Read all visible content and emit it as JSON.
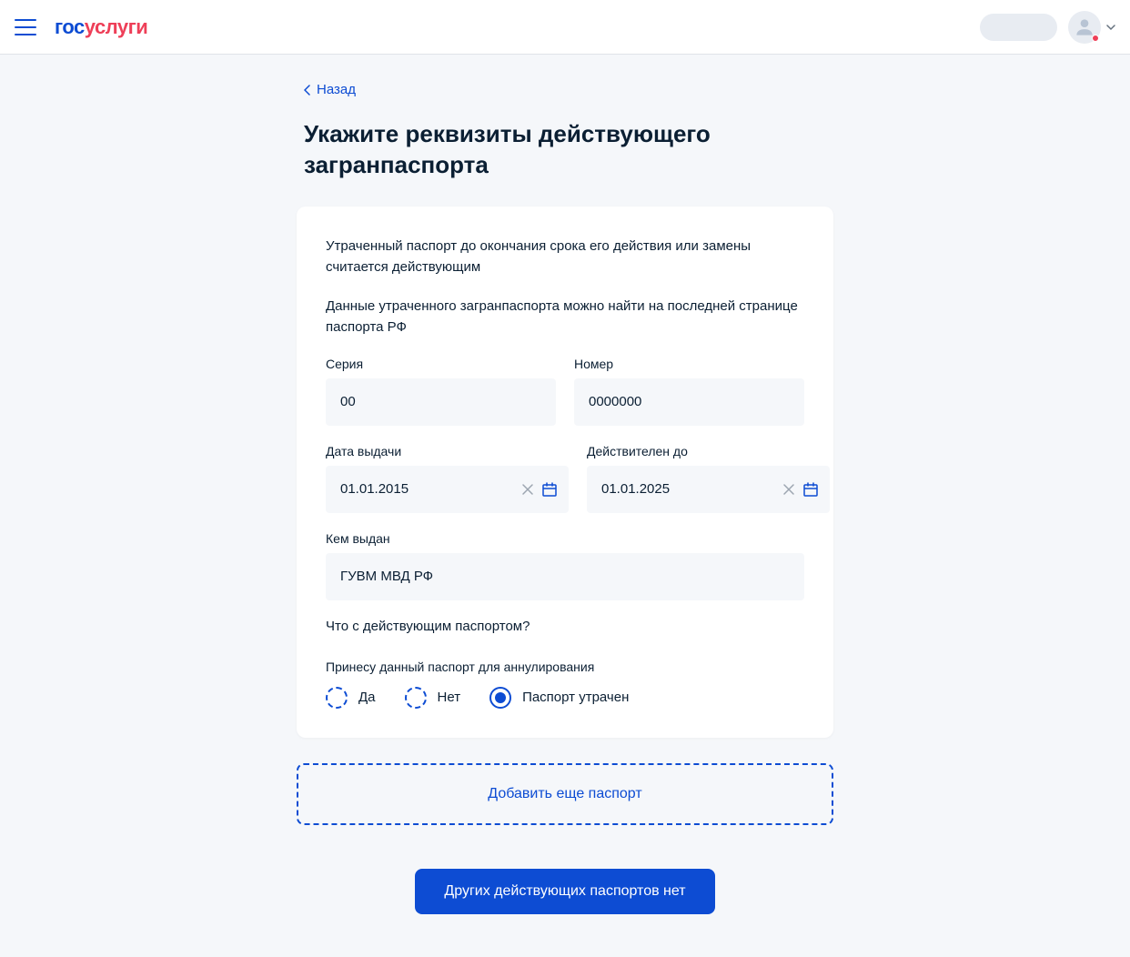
{
  "header": {
    "logo_part1": "гос",
    "logo_part2": "услуги"
  },
  "back": {
    "label": "Назад"
  },
  "page": {
    "title": "Укажите реквизиты действующего загранпаспорта"
  },
  "card": {
    "info1": "Утраченный паспорт до окончания срока его действия или замены считается действующим",
    "info2": "Данные утраченного загранпаспорта можно найти на последней странице паспорта РФ",
    "fields": {
      "series_label": "Серия",
      "series_value": "00",
      "number_label": "Номер",
      "number_value": "0000000",
      "issue_date_label": "Дата выдачи",
      "issue_date_value": "01.01.2015",
      "valid_until_label": "Действителен до",
      "valid_until_value": "01.01.2025",
      "issued_by_label": "Кем выдан",
      "issued_by_value": "ГУВМ МВД РФ"
    },
    "question": "Что с действующим паспортом?",
    "radio_group_label": "Принесу данный паспорт для аннулирования",
    "radio_options": {
      "yes": "Да",
      "no": "Нет",
      "lost": "Паспорт утрачен"
    }
  },
  "buttons": {
    "add_passport": "Добавить еще паспорт",
    "no_more_passports": "Других действующих паспортов нет"
  }
}
